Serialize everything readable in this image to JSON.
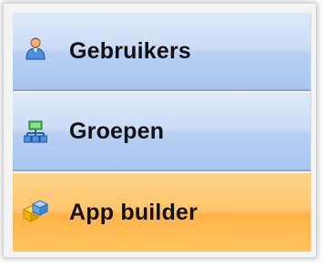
{
  "menu": {
    "items": [
      {
        "label": "Gebruikers",
        "icon": "user-icon",
        "state": "normal"
      },
      {
        "label": "Groepen",
        "icon": "group-network-icon",
        "state": "normal"
      },
      {
        "label": "App builder",
        "icon": "app-builder-blocks-icon",
        "state": "selected"
      }
    ]
  },
  "colors": {
    "item_background": "#cbdcf6",
    "item_selected_background": "#ffc56d",
    "label_text": "#111111"
  }
}
